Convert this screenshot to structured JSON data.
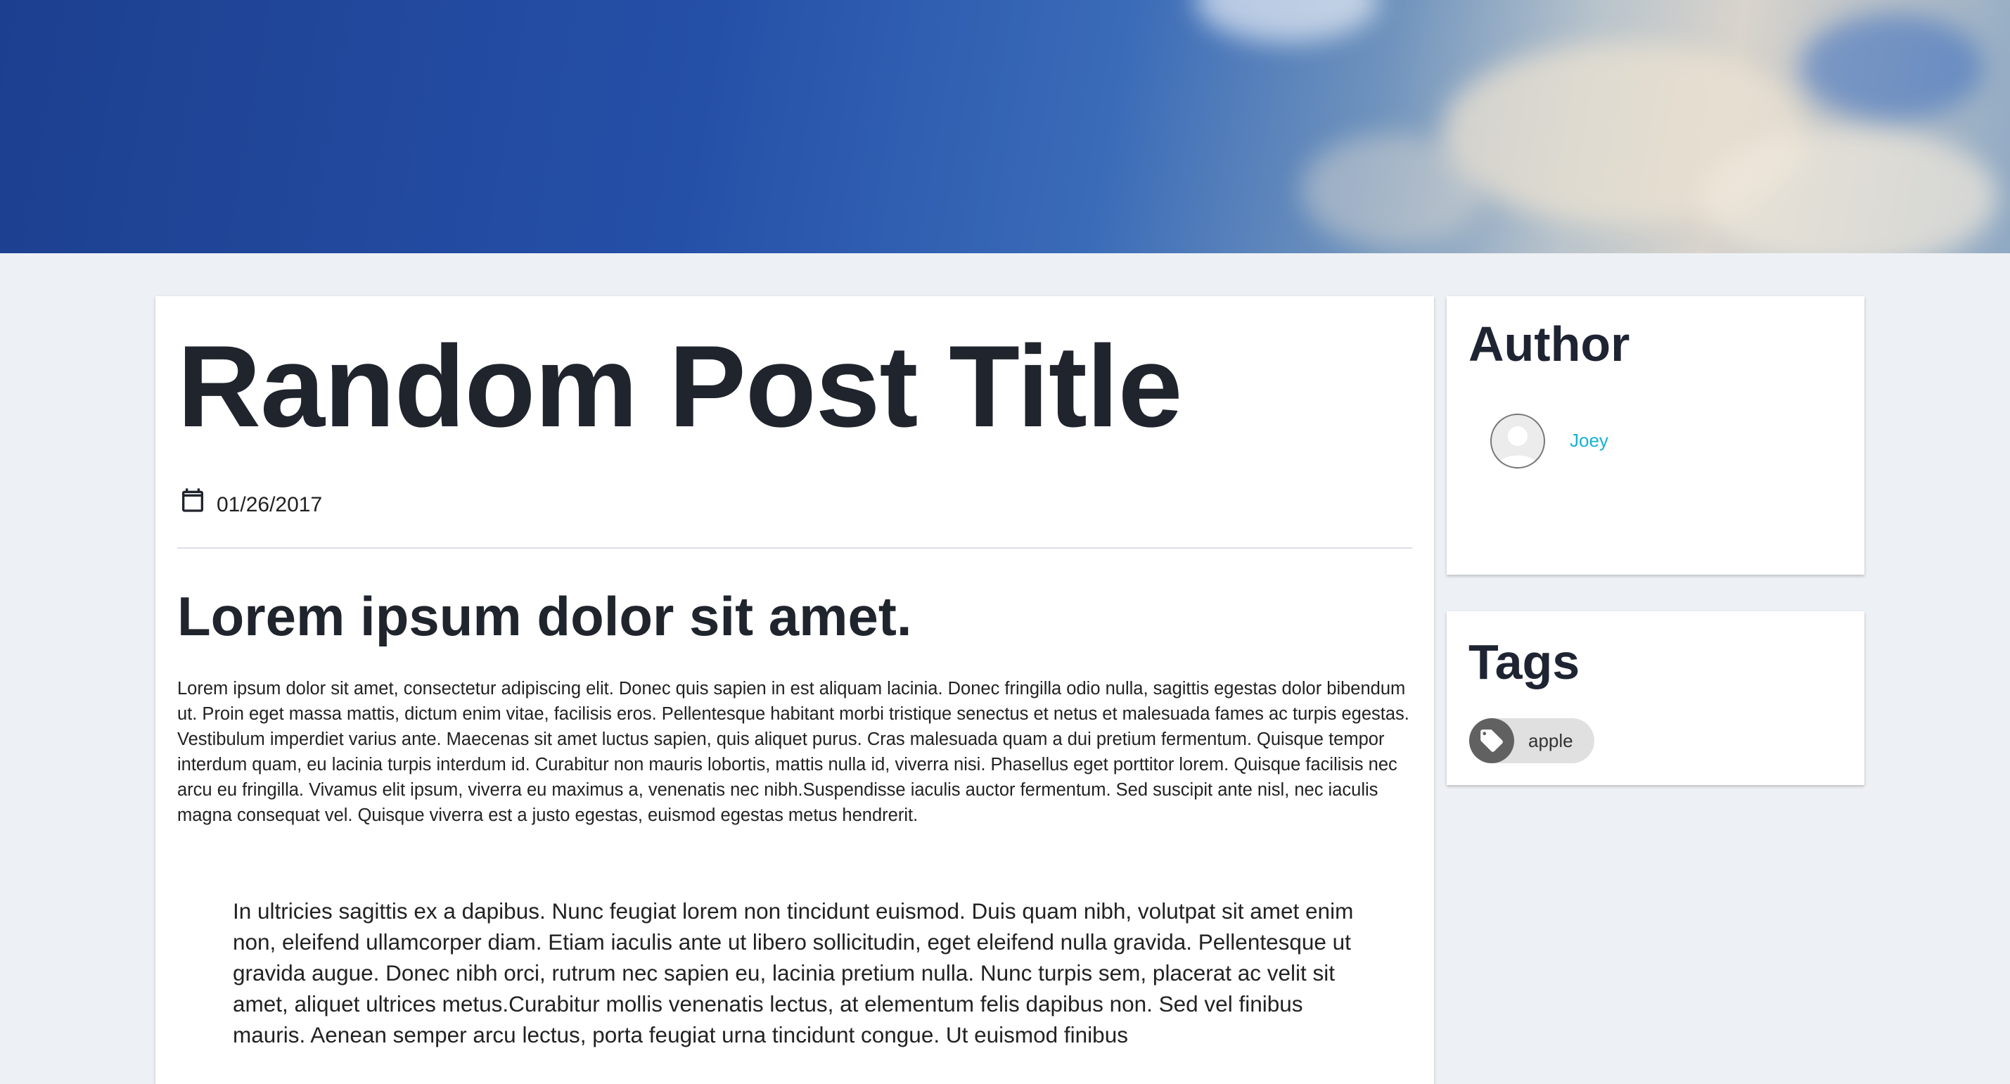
{
  "post": {
    "title": "Random Post Title",
    "date": "01/26/2017",
    "subheading": "Lorem ipsum dolor sit amet.",
    "paragraph": "Lorem ipsum dolor sit amet, consectetur adipiscing elit. Donec quis sapien in est aliquam lacinia. Donec fringilla odio nulla, sagittis egestas dolor bibendum ut. Proin eget massa mattis, dictum enim vitae, facilisis eros. Pellentesque habitant morbi tristique senectus et netus et malesuada fames ac turpis egestas. Vestibulum imperdiet varius ante. Maecenas sit amet luctus sapien, quis aliquet purus. Cras malesuada quam a dui pretium fermentum. Quisque tempor interdum quam, eu lacinia turpis interdum id. Curabitur non mauris lobortis, mattis nulla id, viverra nisi. Phasellus eget porttitor lorem. Quisque facilisis nec arcu eu fringilla. Vivamus elit ipsum, viverra eu maximus a, venenatis nec nibh.Suspendisse iaculis auctor fermentum. Sed suscipit ante nisl, nec iaculis magna consequat vel. Quisque viverra est a justo egestas, euismod egestas metus hendrerit.",
    "quote": " In ultricies sagittis ex a dapibus. Nunc feugiat lorem non tincidunt euismod. Duis quam nibh, volutpat sit amet enim non, eleifend ullamcorper diam. Etiam iaculis ante ut libero sollicitudin, eget eleifend nulla gravida. Pellentesque ut gravida augue. Donec nibh orci, rutrum nec sapien eu, lacinia pretium nulla. Nunc turpis sem, placerat ac velit sit amet, aliquet ultrices metus.Curabitur mollis venenatis lectus, at elementum felis dapibus non. Sed vel finibus mauris. Aenean semper arcu lectus, porta feugiat urna tincidunt congue. Ut euismod finibus"
  },
  "sidebar": {
    "author": {
      "heading": "Author",
      "name": "Joey"
    },
    "tags": {
      "heading": "Tags",
      "items": [
        {
          "label": "apple"
        }
      ]
    }
  },
  "icons": {
    "date": "calendar-icon",
    "avatar": "user-avatar-icon",
    "tag": "tag-icon"
  },
  "colors": {
    "page_background": "#edf0f4",
    "author_link": "#17b2d0",
    "heading_text": "#20242c",
    "tag_chip": "#e0e0e0",
    "tag_icon_bg": "#616161"
  }
}
